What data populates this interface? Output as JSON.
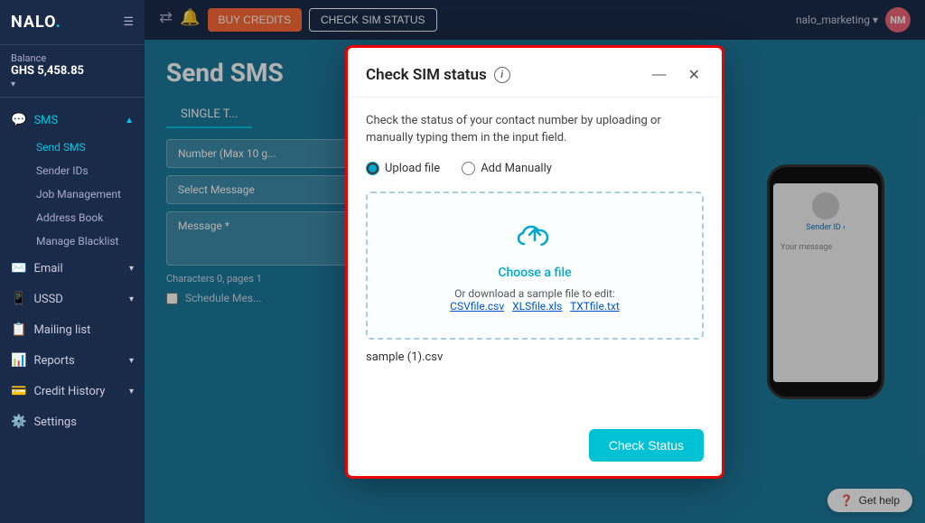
{
  "sidebar": {
    "logo": "NALO",
    "balance_label": "Balance",
    "balance_amount": "GHS 5,458.85",
    "nav_items": [
      {
        "id": "sms",
        "label": "SMS",
        "icon": "💬",
        "active": true
      },
      {
        "id": "send-sms",
        "label": "Send SMS",
        "sub": true,
        "active": true
      },
      {
        "id": "sender-ids",
        "label": "Sender IDs",
        "sub": true
      },
      {
        "id": "job-management",
        "label": "Job Management",
        "sub": true
      },
      {
        "id": "address-book",
        "label": "Address Book",
        "sub": true
      },
      {
        "id": "manage-blacklist",
        "label": "Manage Blacklist",
        "sub": true
      },
      {
        "id": "email",
        "label": "Email",
        "icon": "✉️"
      },
      {
        "id": "ussd",
        "label": "USSD",
        "icon": "📱"
      },
      {
        "id": "mailing-list",
        "label": "Mailing list",
        "icon": "📋"
      },
      {
        "id": "reports",
        "label": "Reports",
        "icon": "📊"
      },
      {
        "id": "credit-history",
        "label": "Credit History",
        "icon": "💳"
      },
      {
        "id": "settings",
        "label": "Settings",
        "icon": "⚙️"
      }
    ]
  },
  "topbar": {
    "btn_buy": "BUY CREDITS",
    "btn_check": "CHECK SIM STATUS",
    "user_name": "nalo_marketing ▾"
  },
  "page": {
    "title": "Send SMS"
  },
  "tabs": [
    {
      "id": "single",
      "label": "SINGLE T..."
    }
  ],
  "form": {
    "number_placeholder": "Number (Max 10 g...",
    "message_placeholder": "Select Message",
    "message_area_placeholder": "Message *",
    "characters_label": "Characters 0, pages 1",
    "schedule_label": "Schedule Mes..."
  },
  "modal": {
    "title": "Check SIM status",
    "description": "Check the status of your contact number by uploading or manually typing them in the input field.",
    "radio_upload": "Upload file",
    "radio_manual": "Add Manually",
    "upload_placeholder": "Choose a file",
    "sample_text": "Or download a sample file to edit:",
    "sample_csv": "CSVfile.csv",
    "sample_xls": "XLSfile.xls",
    "sample_txt": "TXTfile.txt",
    "file_name": "sample (1).csv",
    "btn_check": "Check Status",
    "minimize_icon": "—",
    "close_icon": "✕"
  },
  "phone": {
    "sender_id": "Sender ID ›",
    "your_message": "Your message"
  },
  "get_help": "Get help"
}
